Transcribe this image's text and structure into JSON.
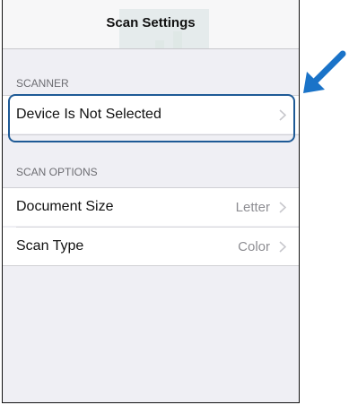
{
  "navbar": {
    "title": "Scan Settings"
  },
  "sections": {
    "scanner": {
      "header": "SCANNER",
      "device_label": "Device Is Not Selected"
    },
    "scan_options": {
      "header": "SCAN OPTIONS",
      "document_size": {
        "label": "Document Size",
        "value": "Letter"
      },
      "scan_type": {
        "label": "Scan Type",
        "value": "Color"
      }
    }
  },
  "colors": {
    "highlight": "#1e5a96",
    "arrow": "#1a73c8",
    "background": "#efeff4"
  },
  "icons": [
    "chevron-right-icon",
    "pointer-arrow-icon"
  ]
}
